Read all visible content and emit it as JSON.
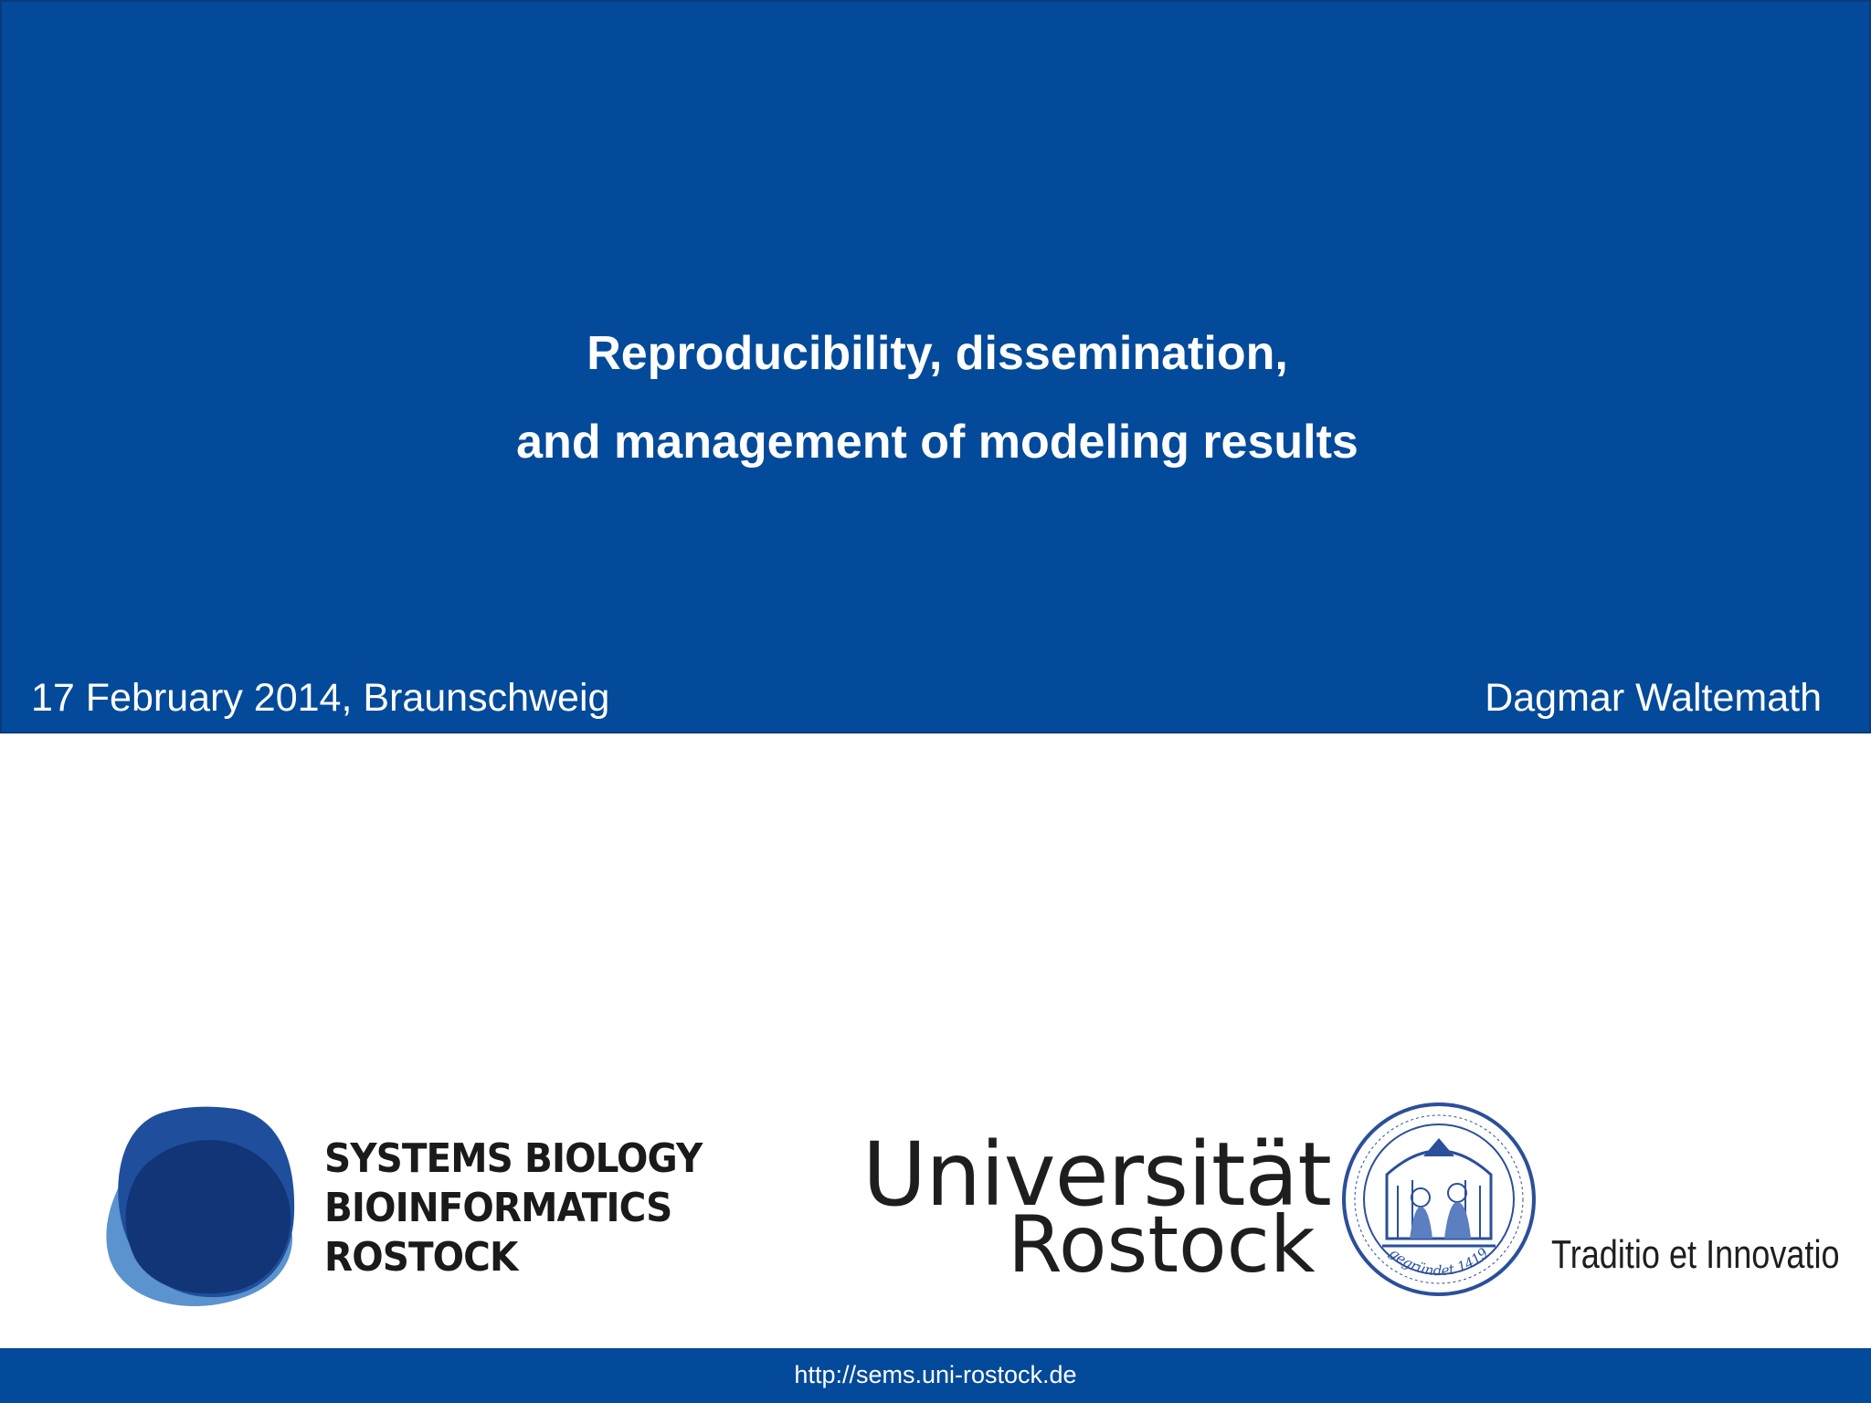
{
  "slide": {
    "title_line1": "Reproducibility, dissemination,",
    "title_line2": "and management of modeling results",
    "date_place": "17 February 2014, Braunschweig",
    "author": "Dagmar Waltemath"
  },
  "logos": {
    "sbbr": {
      "line1": "SYSTEMS BIOLOGY",
      "line2": "BIOINFORMATICS",
      "line3": "ROSTOCK",
      "icon": "overlapping-blue-blobs-icon"
    },
    "university": {
      "word1": "Universität",
      "word2": "Rostock",
      "seal_icon": "university-seal-icon",
      "seal_text": "gegründet 1419",
      "motto": "Traditio et Innovatio"
    }
  },
  "footer": {
    "url": "http://sems.uni-rostock.de"
  },
  "colors": {
    "brand_blue": "#044a9a",
    "white": "#ffffff"
  }
}
